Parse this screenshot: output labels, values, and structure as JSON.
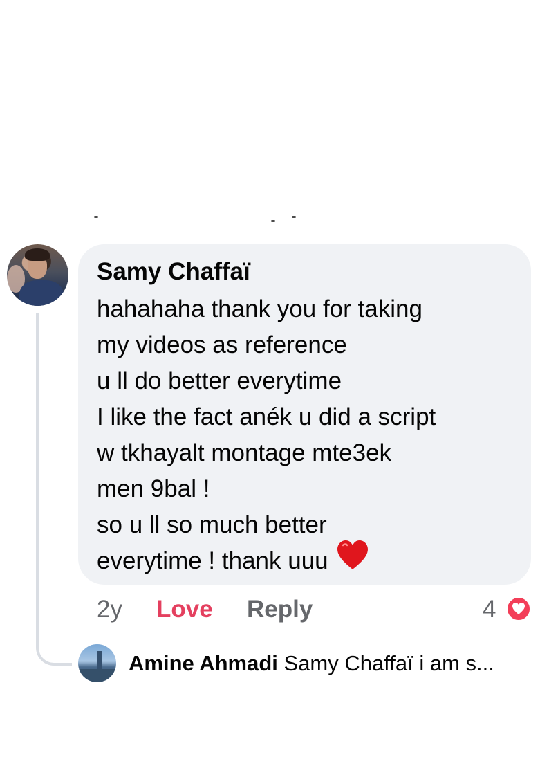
{
  "comment": {
    "author": "Samy Chaffaï",
    "lines": [
      "hahahaha thank you for taking",
      "my videos as reference",
      "u ll do better everytime",
      "I like the fact anék u did a script",
      "w tkhayalt montage mte3ek",
      "men 9bal !",
      "so u ll so much better",
      "everytime ! thank uuu"
    ],
    "emoji": "heart-emoji"
  },
  "actions": {
    "time": "2y",
    "love_label": "Love",
    "reply_label": "Reply",
    "reaction_count": "4",
    "reaction_icon": "love-reaction-icon"
  },
  "reply_preview": {
    "author": "Amine Ahmadi",
    "snippet": "Samy Chaffaï i am s..."
  },
  "colors": {
    "bubble": "#f0f2f5",
    "love": "#e4405f",
    "muted": "#65676b",
    "text": "#050505",
    "thread_line": "#d9dde3"
  }
}
